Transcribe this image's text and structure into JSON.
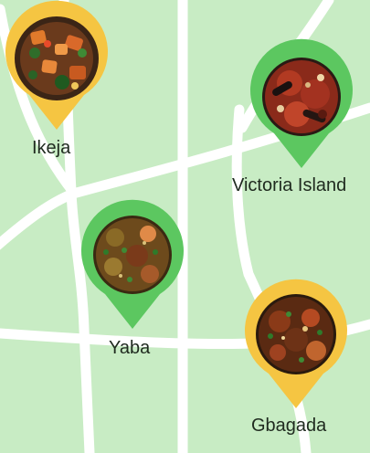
{
  "map": {
    "background_color": "#c8ecc4",
    "road_color": "#ffffff",
    "pins": [
      {
        "id": "ikeja",
        "label": "Ikeja",
        "pin_color": "#f5c542",
        "photo_icon": "dish-photo-stew-icon"
      },
      {
        "id": "victoria-island",
        "label": "Victoria Island",
        "pin_color": "#5cc760",
        "photo_icon": "dish-photo-jollof-icon"
      },
      {
        "id": "yaba",
        "label": "Yaba",
        "pin_color": "#5cc760",
        "photo_icon": "dish-photo-okra-icon"
      },
      {
        "id": "gbagada",
        "label": "Gbagada",
        "pin_color": "#f5c542",
        "photo_icon": "dish-photo-efo-icon"
      }
    ]
  }
}
